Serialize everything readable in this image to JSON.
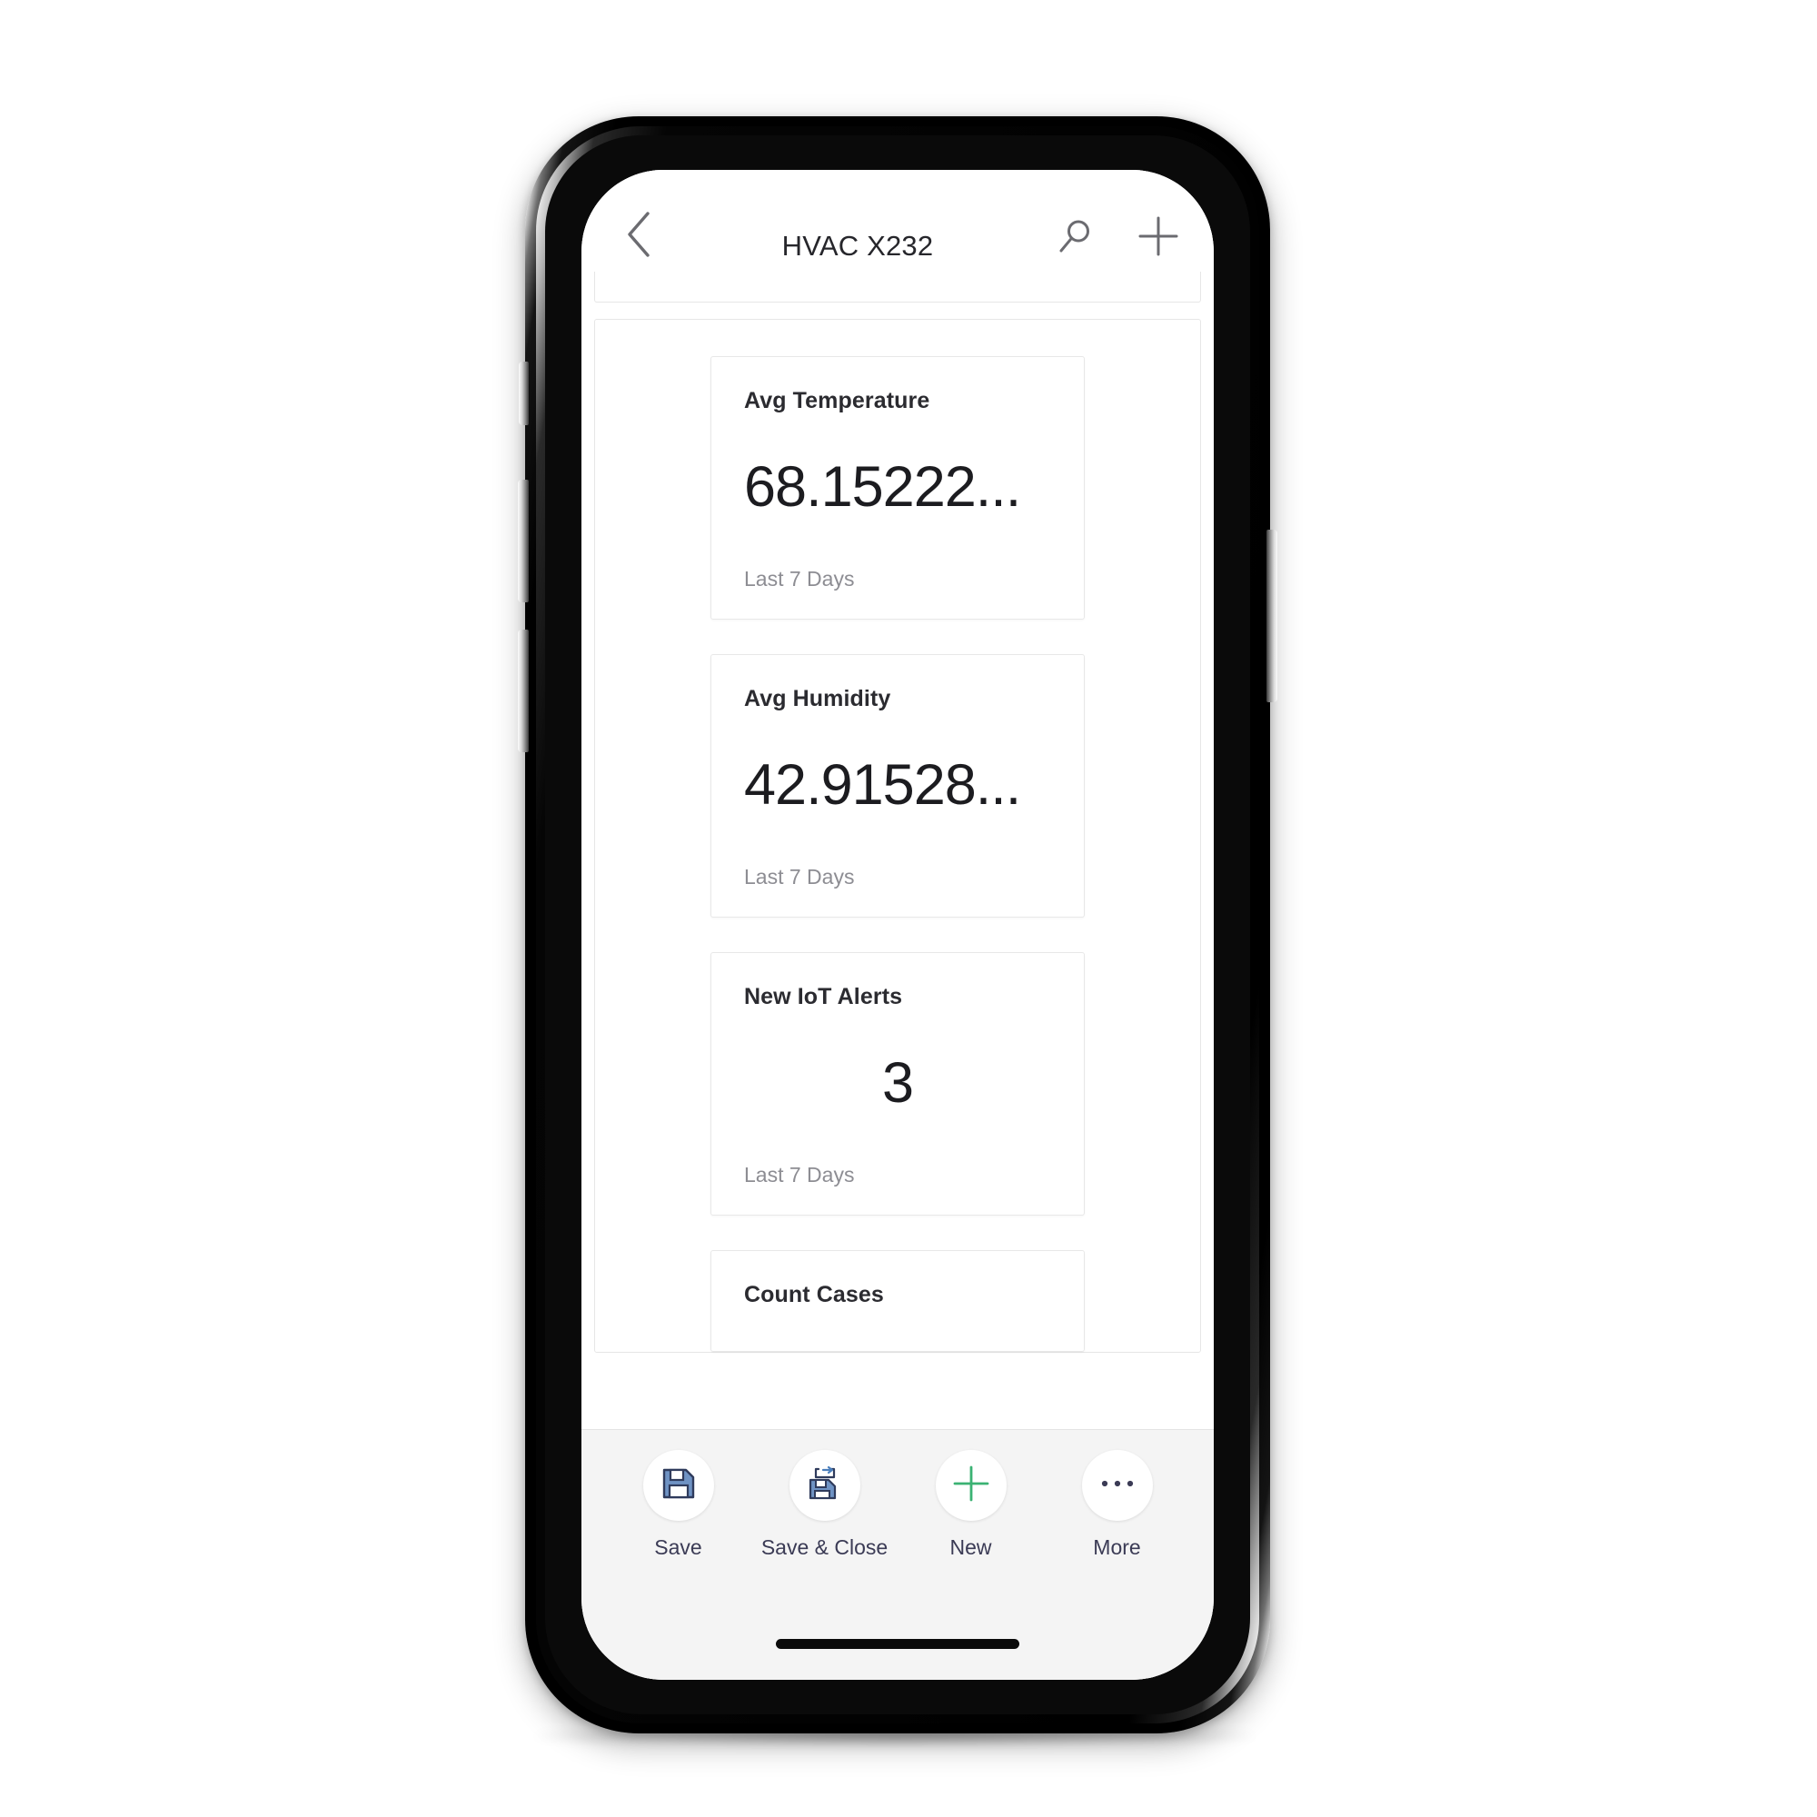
{
  "app": {
    "navbar": {
      "back_icon": "chevron-left-icon",
      "title": "HVAC X232",
      "search_icon": "search-icon",
      "add_icon": "plus-icon"
    },
    "cards": [
      {
        "title": "Avg Temperature",
        "value": "68.15222...",
        "footer": "Last 7 Days",
        "align": "left"
      },
      {
        "title": "Avg Humidity",
        "value": "42.91528...",
        "footer": "Last 7 Days",
        "align": "left"
      },
      {
        "title": "New IoT Alerts",
        "value": "3",
        "footer": "Last 7 Days",
        "align": "center"
      },
      {
        "title": "Count Cases",
        "value": "",
        "footer": "",
        "align": "left"
      }
    ],
    "commandbar": {
      "items": [
        {
          "label": "Save",
          "icon": "save-floppy-icon"
        },
        {
          "label": "Save & Close",
          "icon": "save-and-close-icon"
        },
        {
          "label": "New",
          "icon": "plus-icon"
        },
        {
          "label": "More",
          "icon": "ellipsis-icon"
        }
      ]
    },
    "colors": {
      "save_icon_blue": "#4a7ebb",
      "save_icon_dark": "#2f3b5c",
      "new_icon_green": "#3bb273",
      "command_label": "#3b3b55",
      "card_value": "#1c1c20",
      "card_footer": "#8d8d93"
    },
    "home_indicator": "home-indicator-bar"
  }
}
